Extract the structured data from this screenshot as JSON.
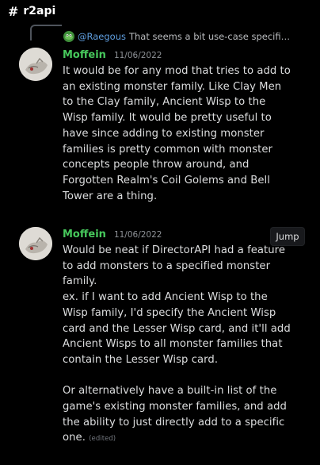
{
  "channel": {
    "icon": "hash-icon",
    "hash": "#",
    "name": "r2api"
  },
  "reply": {
    "author": "@Raegous",
    "text": "That seems a bit use-case specifi…",
    "avatar_color": "#3f8f3a"
  },
  "messages": [
    {
      "author": "Moffein",
      "timestamp": "11/06/2022",
      "author_color": "#47c95c",
      "body": "It would be for any mod that tries to add to\nan existing monster family. Like Clay Men\nto the Clay family, Ancient Wisp to the\nWisp family. It would be pretty useful to\nhave since adding to existing monster\nfamilies is pretty common with monster\nconcepts people throw around, and\nForgotten Realm's Coil Golems and Bell\nTower are a thing."
    },
    {
      "author": "Moffein",
      "timestamp": "11/06/2022",
      "author_color": "#47c95c",
      "body": "Would be neat if DirectorAPI had a feature\nto add monsters to a specified monster\nfamily.\nex. if I want to add Ancient Wisp to the\nWisp family, I'd specify the Ancient Wisp\ncard and the Lesser Wisp card, and it'll add\nAncient Wisps to all monster families that\ncontain the Lesser Wisp card.\n\nOr alternatively have a built-in list of the\ngame's existing monster families, and add\nthe ability to just directly add to a specific\none.",
      "edited": "(edited)",
      "jump_label": "Jump"
    }
  ]
}
